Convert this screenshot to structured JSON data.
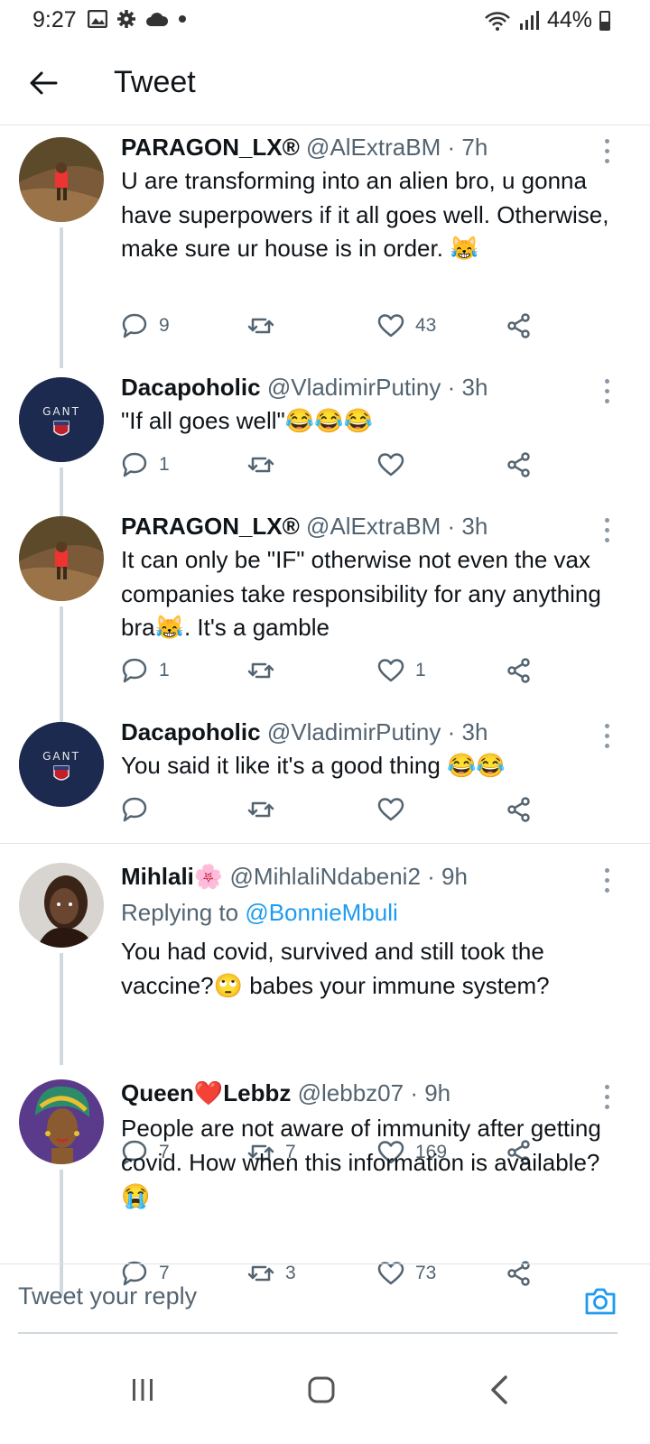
{
  "status_bar": {
    "time": "9:27",
    "battery": "44%"
  },
  "header": {
    "title": "Tweet"
  },
  "tweets": [
    {
      "name": "PARAGON_LX®",
      "handle": "@AlExtraBM",
      "time": "· 7h",
      "text": "U are transforming into an alien bro, u gonna have superpowers if it all goes well. Otherwise, make sure ur house is in order. 😹",
      "replies": "9",
      "retweets": "",
      "likes": "43"
    },
    {
      "name": "Dacapoholic",
      "handle": "@VladimirPutiny",
      "time": "· 3h",
      "text": "\"If all goes well\"😂😂😂",
      "replies": "1",
      "retweets": "",
      "likes": ""
    },
    {
      "name": "PARAGON_LX®",
      "handle": "@AlExtraBM",
      "time": "· 3h",
      "text": "It can only be \"IF\" otherwise not even the vax companies take responsibility for any anything bra😹. It's a gamble",
      "replies": "1",
      "retweets": "",
      "likes": "1"
    },
    {
      "name": "Dacapoholic",
      "handle": "@VladimirPutiny",
      "time": "· 3h",
      "text": "You said it like it's a good thing 😂😂",
      "replies": "",
      "retweets": "",
      "likes": ""
    },
    {
      "name": "Mihlali🌸",
      "handle": "@MihlaliNdabeni2",
      "time": "· 9h",
      "reply_prefix": "Replying to",
      "reply_to": "@BonnieMbuli",
      "text": "You had covid, survived and still took the vaccine?🙄 babes your immune system?",
      "replies": "7",
      "retweets": "7",
      "likes": "169"
    },
    {
      "name": "Queen❤️Lebbz",
      "handle": "@lebbz07",
      "time": "· 9h",
      "text": "People are not aware of immunity after getting covid. How when this information is available?😭",
      "replies": "7",
      "retweets": "3",
      "likes": "73"
    }
  ],
  "reply_box": {
    "placeholder": "Tweet your reply"
  },
  "icons": {
    "reply": "reply-icon",
    "retweet": "retweet-icon",
    "like": "heart-icon",
    "share": "share-icon",
    "more": "more-vertical-icon",
    "back": "arrow-left-icon",
    "camera": "camera-icon"
  },
  "colors": {
    "accent": "#1d9bf0",
    "muted": "#536471",
    "text": "#0f1419",
    "avatar_gant": "#1c2a4f"
  }
}
